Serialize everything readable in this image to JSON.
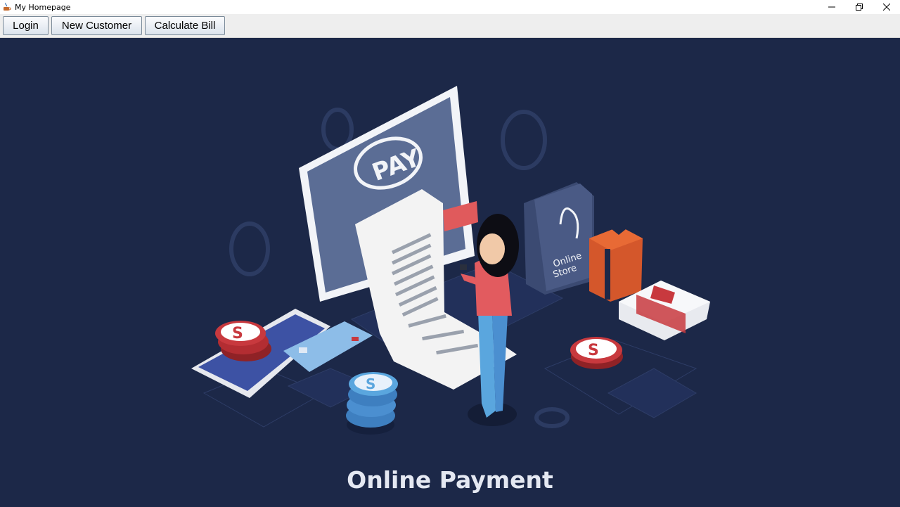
{
  "window": {
    "title": "My Homepage",
    "icon": "java-cup-icon",
    "controls": [
      "minimize-icon",
      "restore-icon",
      "close-icon"
    ]
  },
  "toolbar": {
    "login_label": "Login",
    "new_customer_label": "New Customer",
    "calculate_bill_label": "Calculate Bill"
  },
  "banner": {
    "pay_text": "PAY",
    "bag_text_line1": "Online",
    "bag_text_line2": "Store",
    "coin_symbol": "S",
    "caption": "Online Payment"
  },
  "colors": {
    "background": "#1c2848",
    "accent_red": "#c8393e",
    "accent_blue": "#5aa6de"
  }
}
